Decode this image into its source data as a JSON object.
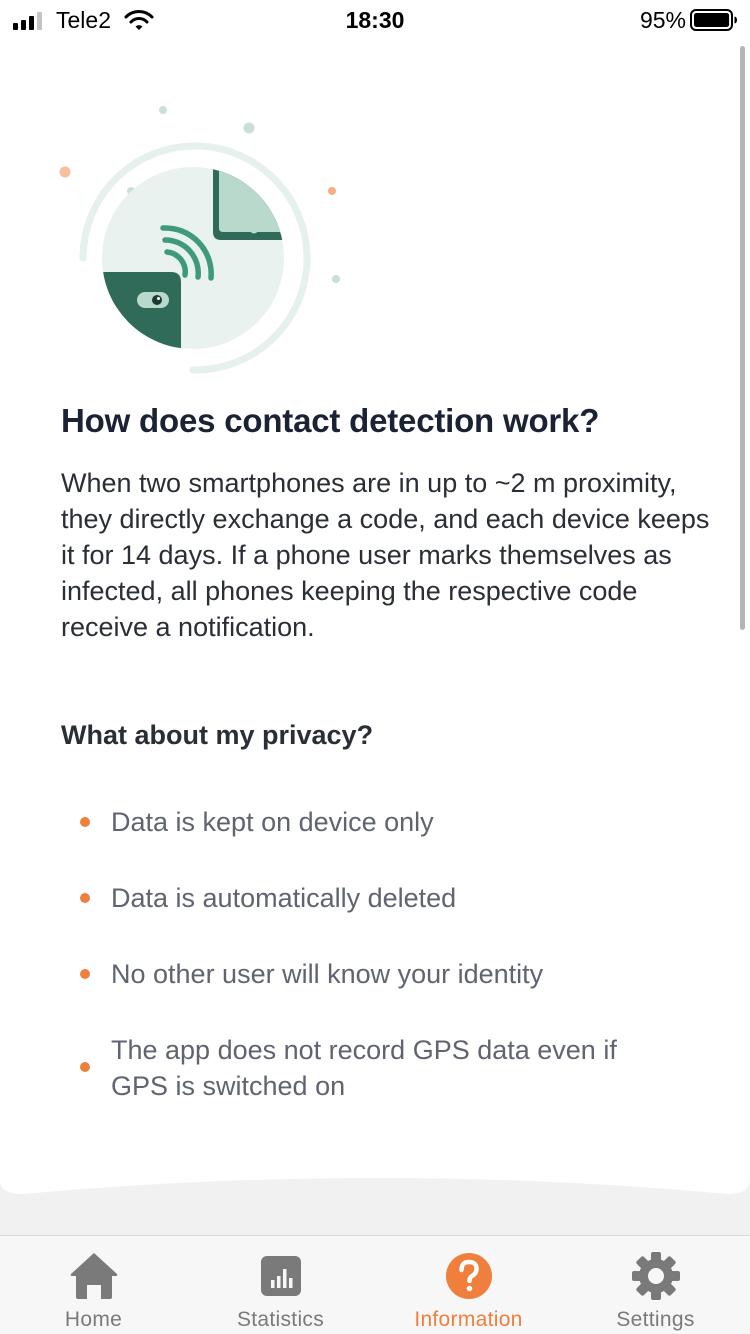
{
  "status_bar": {
    "carrier": "Tele2",
    "time": "18:30",
    "battery_percent": "95%",
    "battery_level": 0.95,
    "signal_bars": 3
  },
  "illustration": {
    "icon": "phones-contact-exchange-illustration",
    "colors": {
      "dark_green": "#2f6b58",
      "mid_green": "#3d9a7c",
      "pale_green": "#e6f0ec",
      "light_green": "#b8d9cc",
      "accent_orange": "#f6ac84"
    }
  },
  "content": {
    "heading": "How does contact detection work?",
    "body": "When two smartphones are in up to ~2 m proximity, they directly exchange a code, and each device keeps it for 14 days. If a phone user marks themselves as infected, all phones keeping the respective code receive a notification.",
    "privacy_heading": "What about my privacy?",
    "privacy_points": [
      "Data is kept on device only",
      "Data is automatically deleted",
      "No other user will know your identity",
      "The app does not record GPS data even if GPS is switched on"
    ]
  },
  "tab_bar": {
    "tabs": [
      {
        "label": "Home",
        "icon": "home-icon"
      },
      {
        "label": "Statistics",
        "icon": "bar-chart-icon"
      },
      {
        "label": "Information",
        "icon": "question-icon",
        "active": true
      },
      {
        "label": "Settings",
        "icon": "gear-icon"
      }
    ]
  },
  "colors": {
    "accent": "#f07e3d",
    "inactive_tab": "#7a7a7a",
    "heading": "#1a2234",
    "text": "#2a2e36",
    "muted_text": "#5f6470"
  }
}
